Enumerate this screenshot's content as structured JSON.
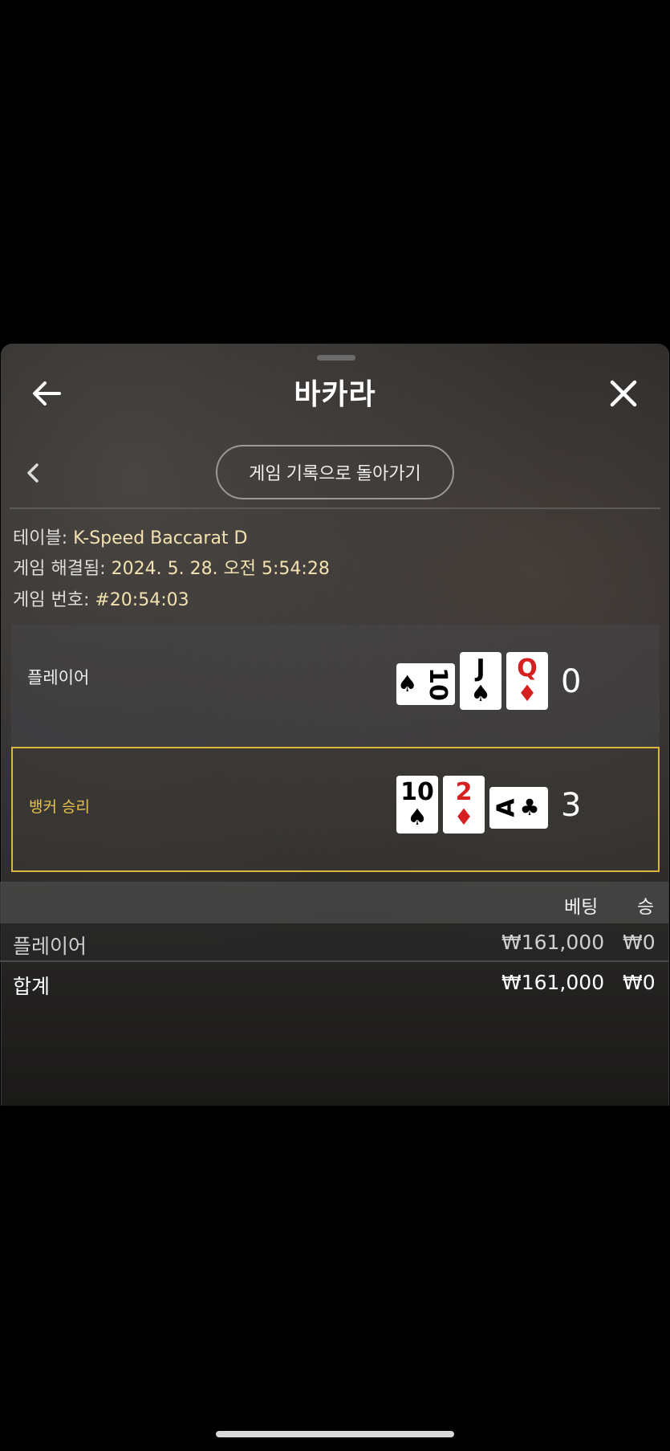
{
  "header": {
    "title": "바카라"
  },
  "nav": {
    "back_to_history_label": "게임 기록으로 돌아가기"
  },
  "info": {
    "table_label": "테이블:",
    "table_value": "K-Speed Baccarat D",
    "resolved_label": "게임 해결됨:",
    "resolved_value": "2024. 5. 28. 오전 5:54:28",
    "game_no_label": "게임 번호:",
    "game_no_value": "#20:54:03"
  },
  "player": {
    "label": "플레이어",
    "score": "0",
    "cards": [
      {
        "rank": "10",
        "suit": "♠",
        "color": "black",
        "orientation": "sideways"
      },
      {
        "rank": "J",
        "suit": "♠",
        "color": "black",
        "orientation": "upright"
      },
      {
        "rank": "Q",
        "suit": "♦",
        "color": "red",
        "orientation": "upright"
      }
    ]
  },
  "banker": {
    "label": "뱅커 승리",
    "score": "3",
    "cards": [
      {
        "rank": "10",
        "suit": "♠",
        "color": "black",
        "orientation": "upright"
      },
      {
        "rank": "2",
        "suit": "♦",
        "color": "red",
        "orientation": "upright"
      },
      {
        "rank": "A",
        "suit": "♣",
        "color": "black",
        "orientation": "sideways"
      }
    ]
  },
  "bets_table": {
    "headers": [
      "베팅",
      "승"
    ],
    "rows": [
      {
        "name": "플레이어",
        "bet": "₩161,000",
        "win": "₩0"
      }
    ],
    "total": {
      "name": "합계",
      "bet": "₩161,000",
      "win": "₩0"
    }
  },
  "colors": {
    "banker_accent": "#d9b83a",
    "red_suit": "#d61f1f",
    "info_value": "#f3e2b0"
  },
  "icons": [
    "back-arrow-icon",
    "close-icon",
    "chevron-left-icon"
  ]
}
